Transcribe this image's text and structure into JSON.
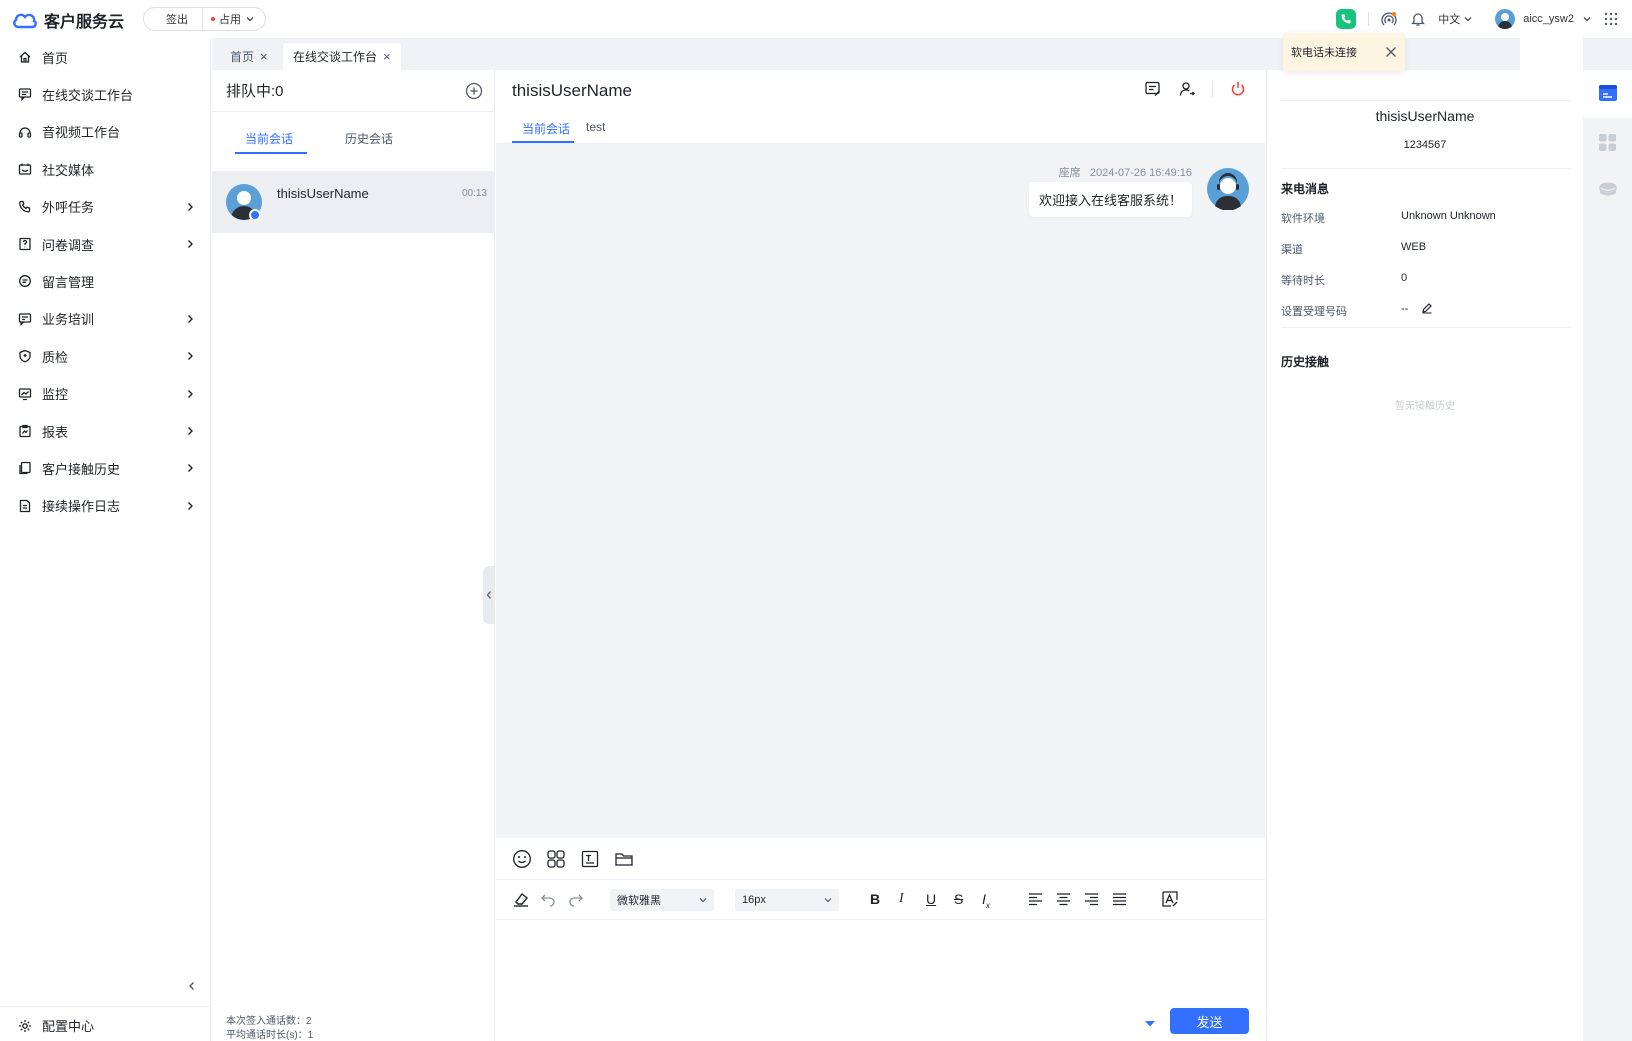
{
  "app": {
    "title": "客户服务云"
  },
  "status": {
    "signout": "签出",
    "occupied": "占用"
  },
  "top": {
    "language": "中文",
    "user": "aicc_ysw2"
  },
  "toast": {
    "text": "软电话未连接"
  },
  "sidebar": {
    "items": [
      {
        "label": "首页",
        "icon": "home-icon",
        "has_submenu": false
      },
      {
        "label": "在线交谈工作台",
        "icon": "chat-icon",
        "has_submenu": false
      },
      {
        "label": "音视频工作台",
        "icon": "headset-icon",
        "has_submenu": false
      },
      {
        "label": "社交媒体",
        "icon": "social-icon",
        "has_submenu": false
      },
      {
        "label": "外呼任务",
        "icon": "phone-icon",
        "has_submenu": true
      },
      {
        "label": "问卷调查",
        "icon": "survey-icon",
        "has_submenu": true
      },
      {
        "label": "留言管理",
        "icon": "message-icon",
        "has_submenu": false
      },
      {
        "label": "业务培训",
        "icon": "training-icon",
        "has_submenu": true
      },
      {
        "label": "质检",
        "icon": "shield-icon",
        "has_submenu": true
      },
      {
        "label": "监控",
        "icon": "monitor-icon",
        "has_submenu": true
      },
      {
        "label": "报表",
        "icon": "report-icon",
        "has_submenu": true
      },
      {
        "label": "客户接触历史",
        "icon": "history-icon",
        "has_submenu": true
      },
      {
        "label": "接续操作日志",
        "icon": "log-icon",
        "has_submenu": true
      }
    ],
    "config": "配置中心"
  },
  "tabs": [
    {
      "label": "首页",
      "active": false
    },
    {
      "label": "在线交谈工作台",
      "active": true
    }
  ],
  "queue": {
    "title": "排队中:0",
    "tabs": [
      "当前会话",
      "历史会话"
    ],
    "session": {
      "name": "thisisUserName",
      "time": "00:13"
    },
    "stats": [
      "本次签入通话数：2",
      "平均通话时长(s)：1"
    ]
  },
  "chat": {
    "title": "thisisUserName",
    "tabs": [
      "当前会话",
      "test"
    ],
    "message": {
      "sender": "座席",
      "time": "2024-07-26 16:49:16",
      "text": "欢迎接入在线客服系统！"
    },
    "font": "微软雅黑",
    "size": "16px",
    "send": "发送"
  },
  "info": {
    "name": "thisisUserName",
    "id": "1234567",
    "incoming_title": "来电消息",
    "fields": [
      {
        "label": "软件环境",
        "value": "Unknown Unknown"
      },
      {
        "label": "渠道",
        "value": "WEB"
      },
      {
        "label": "等待时长",
        "value": "0"
      },
      {
        "label": "设置受理号码",
        "value": "--"
      }
    ],
    "history_title": "历史接触",
    "history_empty": "暂无接触历史"
  },
  "colors": {
    "primary": "#3370ff",
    "phone": "#19c37d",
    "danger": "#f53f3f",
    "toast_bg": "#fdf5e1"
  }
}
